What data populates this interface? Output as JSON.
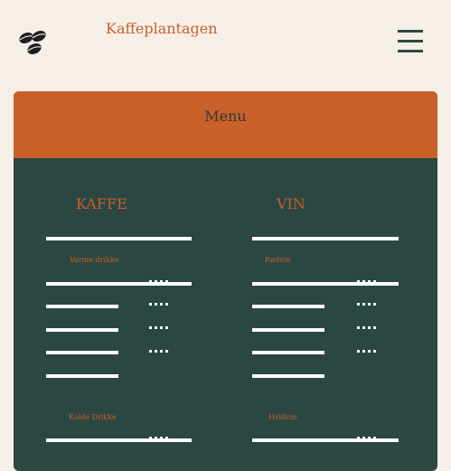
{
  "header": {
    "brand": "Kaffeplantagen",
    "logo_icon": "coffee-beans-icon",
    "menu_icon": "hamburger-menu-icon"
  },
  "card": {
    "title": "Menu"
  },
  "columns": [
    {
      "title": "KAFFE",
      "sections": [
        "Varme drikke",
        "Kolde Drikke"
      ]
    },
    {
      "title": "VIN",
      "sections": [
        "Rødvin",
        "Hvidvin"
      ]
    }
  ],
  "colors": {
    "background": "#f5efe8",
    "accent": "#c95f29",
    "panel": "#2b4741",
    "lines": "#ffffff"
  }
}
